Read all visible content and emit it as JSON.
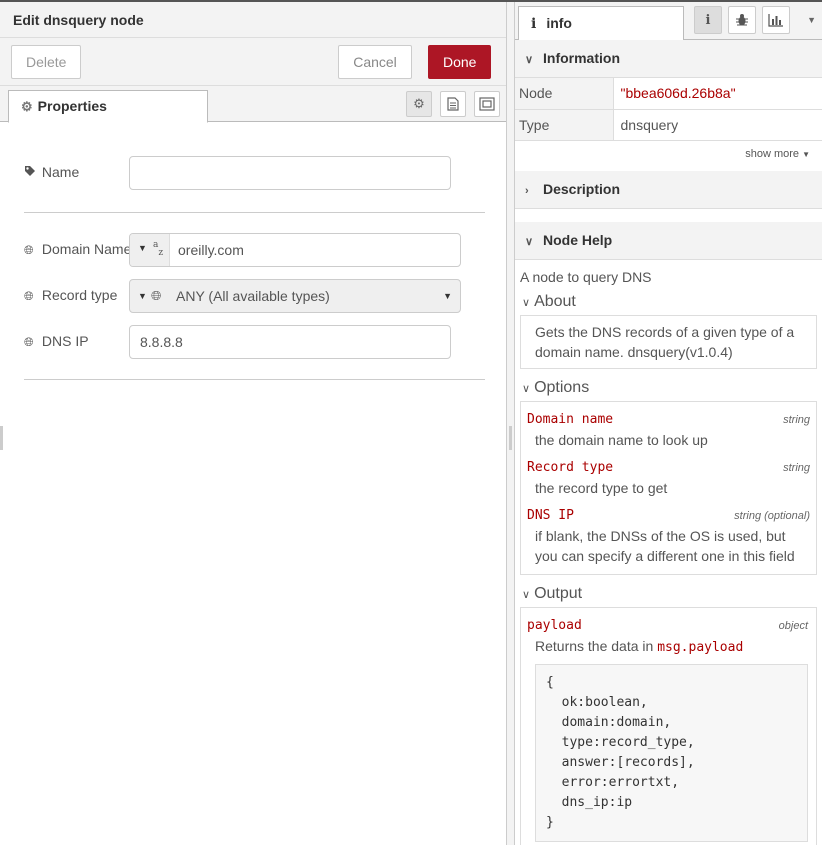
{
  "editor": {
    "title": "Edit dnsquery node",
    "buttons": {
      "delete": "Delete",
      "cancel": "Cancel",
      "done": "Done"
    },
    "tab_label": "Properties",
    "fields": {
      "name_label": "Name",
      "name_value": "",
      "domain_label": "Domain Name",
      "domain_value": "oreilly.com",
      "domain_type_glyph": "az",
      "record_label": "Record type",
      "record_value": "ANY (All available types)",
      "dnsip_label": "DNS IP",
      "dnsip_value": "8.8.8.8"
    }
  },
  "sidebar": {
    "tab_label": "info",
    "information": {
      "heading": "Information",
      "rows": [
        {
          "key": "Node",
          "value": "\"bbea606d.26b8a\""
        },
        {
          "key": "Type",
          "value": "dnsquery"
        }
      ],
      "show_more": "show more"
    },
    "description": {
      "heading": "Description"
    },
    "node_help": {
      "heading": "Node Help",
      "summary": "A node to query DNS",
      "about_title": "About",
      "about_text": "Gets the DNS records of a given type of a domain name. dnsquery(v1.0.4)",
      "options_title": "Options",
      "options": [
        {
          "name": "Domain name",
          "type": "string",
          "desc": "the domain name to look up"
        },
        {
          "name": "Record type",
          "type": "string",
          "desc": "the record type to get"
        },
        {
          "name": "DNS IP",
          "type": "string (optional)",
          "desc": "if blank, the DNSs of the OS is used, but you can specify a different one in this field"
        }
      ],
      "output_title": "Output",
      "output": {
        "name": "payload",
        "type": "object",
        "desc_prefix": "Returns the data in ",
        "desc_code": "msg.payload",
        "code": "{\n  ok:boolean,\n  domain:domain,\n  type:record_type,\n  answer:[records],\n  error:errortxt,\n  dns_ip:ip\n}"
      }
    }
  },
  "colors": {
    "done_button": "#ad1625",
    "help_code": "#aa0000"
  }
}
